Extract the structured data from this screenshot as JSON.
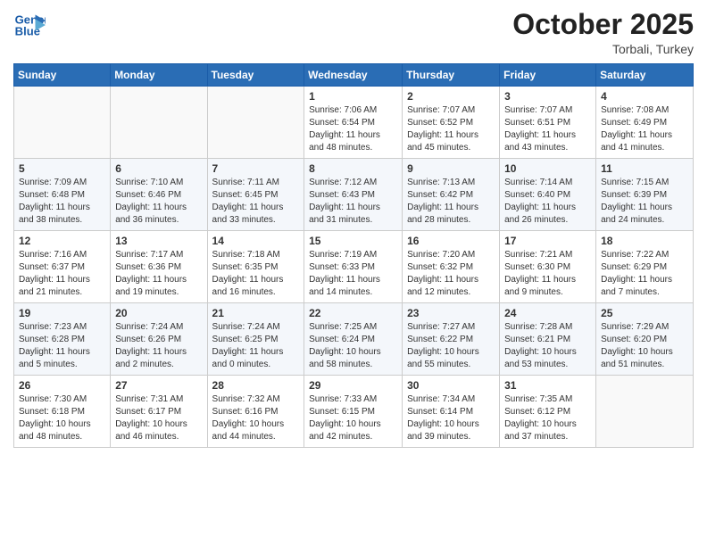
{
  "header": {
    "logo_line1": "General",
    "logo_line2": "Blue",
    "month": "October 2025",
    "location": "Torbali, Turkey"
  },
  "days": [
    "Sunday",
    "Monday",
    "Tuesday",
    "Wednesday",
    "Thursday",
    "Friday",
    "Saturday"
  ],
  "weeks": [
    [
      {
        "num": "",
        "info": ""
      },
      {
        "num": "",
        "info": ""
      },
      {
        "num": "",
        "info": ""
      },
      {
        "num": "1",
        "info": "Sunrise: 7:06 AM\nSunset: 6:54 PM\nDaylight: 11 hours\nand 48 minutes."
      },
      {
        "num": "2",
        "info": "Sunrise: 7:07 AM\nSunset: 6:52 PM\nDaylight: 11 hours\nand 45 minutes."
      },
      {
        "num": "3",
        "info": "Sunrise: 7:07 AM\nSunset: 6:51 PM\nDaylight: 11 hours\nand 43 minutes."
      },
      {
        "num": "4",
        "info": "Sunrise: 7:08 AM\nSunset: 6:49 PM\nDaylight: 11 hours\nand 41 minutes."
      }
    ],
    [
      {
        "num": "5",
        "info": "Sunrise: 7:09 AM\nSunset: 6:48 PM\nDaylight: 11 hours\nand 38 minutes."
      },
      {
        "num": "6",
        "info": "Sunrise: 7:10 AM\nSunset: 6:46 PM\nDaylight: 11 hours\nand 36 minutes."
      },
      {
        "num": "7",
        "info": "Sunrise: 7:11 AM\nSunset: 6:45 PM\nDaylight: 11 hours\nand 33 minutes."
      },
      {
        "num": "8",
        "info": "Sunrise: 7:12 AM\nSunset: 6:43 PM\nDaylight: 11 hours\nand 31 minutes."
      },
      {
        "num": "9",
        "info": "Sunrise: 7:13 AM\nSunset: 6:42 PM\nDaylight: 11 hours\nand 28 minutes."
      },
      {
        "num": "10",
        "info": "Sunrise: 7:14 AM\nSunset: 6:40 PM\nDaylight: 11 hours\nand 26 minutes."
      },
      {
        "num": "11",
        "info": "Sunrise: 7:15 AM\nSunset: 6:39 PM\nDaylight: 11 hours\nand 24 minutes."
      }
    ],
    [
      {
        "num": "12",
        "info": "Sunrise: 7:16 AM\nSunset: 6:37 PM\nDaylight: 11 hours\nand 21 minutes."
      },
      {
        "num": "13",
        "info": "Sunrise: 7:17 AM\nSunset: 6:36 PM\nDaylight: 11 hours\nand 19 minutes."
      },
      {
        "num": "14",
        "info": "Sunrise: 7:18 AM\nSunset: 6:35 PM\nDaylight: 11 hours\nand 16 minutes."
      },
      {
        "num": "15",
        "info": "Sunrise: 7:19 AM\nSunset: 6:33 PM\nDaylight: 11 hours\nand 14 minutes."
      },
      {
        "num": "16",
        "info": "Sunrise: 7:20 AM\nSunset: 6:32 PM\nDaylight: 11 hours\nand 12 minutes."
      },
      {
        "num": "17",
        "info": "Sunrise: 7:21 AM\nSunset: 6:30 PM\nDaylight: 11 hours\nand 9 minutes."
      },
      {
        "num": "18",
        "info": "Sunrise: 7:22 AM\nSunset: 6:29 PM\nDaylight: 11 hours\nand 7 minutes."
      }
    ],
    [
      {
        "num": "19",
        "info": "Sunrise: 7:23 AM\nSunset: 6:28 PM\nDaylight: 11 hours\nand 5 minutes."
      },
      {
        "num": "20",
        "info": "Sunrise: 7:24 AM\nSunset: 6:26 PM\nDaylight: 11 hours\nand 2 minutes."
      },
      {
        "num": "21",
        "info": "Sunrise: 7:24 AM\nSunset: 6:25 PM\nDaylight: 11 hours\nand 0 minutes."
      },
      {
        "num": "22",
        "info": "Sunrise: 7:25 AM\nSunset: 6:24 PM\nDaylight: 10 hours\nand 58 minutes."
      },
      {
        "num": "23",
        "info": "Sunrise: 7:27 AM\nSunset: 6:22 PM\nDaylight: 10 hours\nand 55 minutes."
      },
      {
        "num": "24",
        "info": "Sunrise: 7:28 AM\nSunset: 6:21 PM\nDaylight: 10 hours\nand 53 minutes."
      },
      {
        "num": "25",
        "info": "Sunrise: 7:29 AM\nSunset: 6:20 PM\nDaylight: 10 hours\nand 51 minutes."
      }
    ],
    [
      {
        "num": "26",
        "info": "Sunrise: 7:30 AM\nSunset: 6:18 PM\nDaylight: 10 hours\nand 48 minutes."
      },
      {
        "num": "27",
        "info": "Sunrise: 7:31 AM\nSunset: 6:17 PM\nDaylight: 10 hours\nand 46 minutes."
      },
      {
        "num": "28",
        "info": "Sunrise: 7:32 AM\nSunset: 6:16 PM\nDaylight: 10 hours\nand 44 minutes."
      },
      {
        "num": "29",
        "info": "Sunrise: 7:33 AM\nSunset: 6:15 PM\nDaylight: 10 hours\nand 42 minutes."
      },
      {
        "num": "30",
        "info": "Sunrise: 7:34 AM\nSunset: 6:14 PM\nDaylight: 10 hours\nand 39 minutes."
      },
      {
        "num": "31",
        "info": "Sunrise: 7:35 AM\nSunset: 6:12 PM\nDaylight: 10 hours\nand 37 minutes."
      },
      {
        "num": "",
        "info": ""
      }
    ]
  ]
}
